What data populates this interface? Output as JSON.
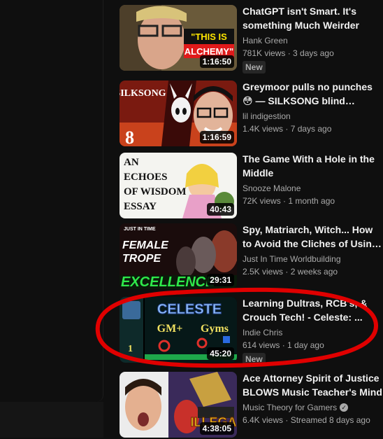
{
  "videos": [
    {
      "title": "ChatGPT isn't Smart. It's something Much Weirder",
      "channel": "Hank Green",
      "stats": "781K views · 3 days ago",
      "duration": "1:16:50",
      "badge": "New",
      "verified": false,
      "thumb_text": [
        "\"THIS IS",
        "ALCHEMY\""
      ]
    },
    {
      "title": "Greymoor pulls no punches 😳 — SILKSONG blind playthrough…",
      "channel": "lil indigestion",
      "stats": "1.4K views · 7 days ago",
      "duration": "1:16:59",
      "badge": "",
      "verified": false,
      "thumb_text": [
        "SILKSONG",
        "8"
      ]
    },
    {
      "title": "The Game With a Hole in the Middle",
      "channel": "Snooze Malone",
      "stats": "72K views · 1 month ago",
      "duration": "40:43",
      "badge": "",
      "verified": false,
      "thumb_text": [
        "AN",
        "ECHOES",
        "OF WISDOM",
        "ESSAY"
      ]
    },
    {
      "title": "Spy, Matriarch, Witch... How to Avoid the Cliches of Using ...",
      "channel": "Just In Time Worldbuilding",
      "stats": "2.5K views · 2 weeks ago",
      "duration": "29:31",
      "badge": "",
      "verified": false,
      "thumb_text": [
        "JUST IN TIME",
        "FEMALE",
        "TROPE",
        "EXCELLENCE"
      ]
    },
    {
      "title": "Learning Dultras, RCB's, & Crouch Tech! - Celeste: ...",
      "channel": "Indie Chris",
      "stats": "614 views · 1 day ago",
      "duration": "45:20",
      "badge": "New",
      "verified": false,
      "thumb_text": [
        "CELESTE",
        "GM+",
        "Gyms",
        "1"
      ]
    },
    {
      "title": "Ace Attorney Spirit of Justice BLOWS Music Teacher's Mind",
      "channel": "Music Theory for Gamers",
      "stats": "6.4K views · Streamed 8 days ago",
      "duration": "4:38:05",
      "badge": "",
      "verified": true,
      "thumb_text": [
        "ILLEGAL"
      ]
    }
  ],
  "colors": {
    "background": "#0f0f0f",
    "annotation": "#e00000"
  }
}
